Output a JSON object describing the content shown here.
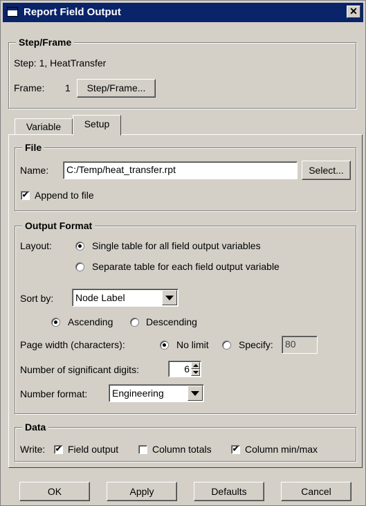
{
  "window": {
    "title": "Report Field Output",
    "close_glyph": "✕"
  },
  "step_frame": {
    "legend": "Step/Frame",
    "step_text": "Step: 1, HeatTransfer",
    "frame_label": "Frame:",
    "frame_value": "1",
    "button": "Step/Frame..."
  },
  "tabs": [
    {
      "label": "Variable",
      "active": false
    },
    {
      "label": "Setup",
      "active": true
    }
  ],
  "file": {
    "legend": "File",
    "name_label": "Name:",
    "name_value": "C:/Temp/heat_transfer.rpt",
    "select_button": "Select...",
    "append_label": "Append to file",
    "append_checked": true
  },
  "output_format": {
    "legend": "Output Format",
    "layout_label": "Layout:",
    "layout_options": [
      {
        "label": "Single table for all field output variables",
        "selected": true
      },
      {
        "label": "Separate table for each field output variable",
        "selected": false
      }
    ],
    "sort_label": "Sort by:",
    "sort_value": "Node Label",
    "order_options": [
      {
        "label": "Ascending",
        "selected": true
      },
      {
        "label": "Descending",
        "selected": false
      }
    ],
    "page_width_label": "Page width (characters):",
    "no_limit_label": "No limit",
    "no_limit_selected": true,
    "specify_label": "Specify:",
    "specify_value": "80",
    "sig_digits_label": "Number of significant digits:",
    "sig_digits_value": "6",
    "number_format_label": "Number format:",
    "number_format_value": "Engineering"
  },
  "data": {
    "legend": "Data",
    "write_label": "Write:",
    "field_output_label": "Field output",
    "field_output_checked": true,
    "column_totals_label": "Column totals",
    "column_totals_checked": false,
    "column_minmax_label": "Column min/max",
    "column_minmax_checked": true
  },
  "buttons": {
    "ok": "OK",
    "apply": "Apply",
    "defaults": "Defaults",
    "cancel": "Cancel"
  },
  "checkmark": "✔"
}
